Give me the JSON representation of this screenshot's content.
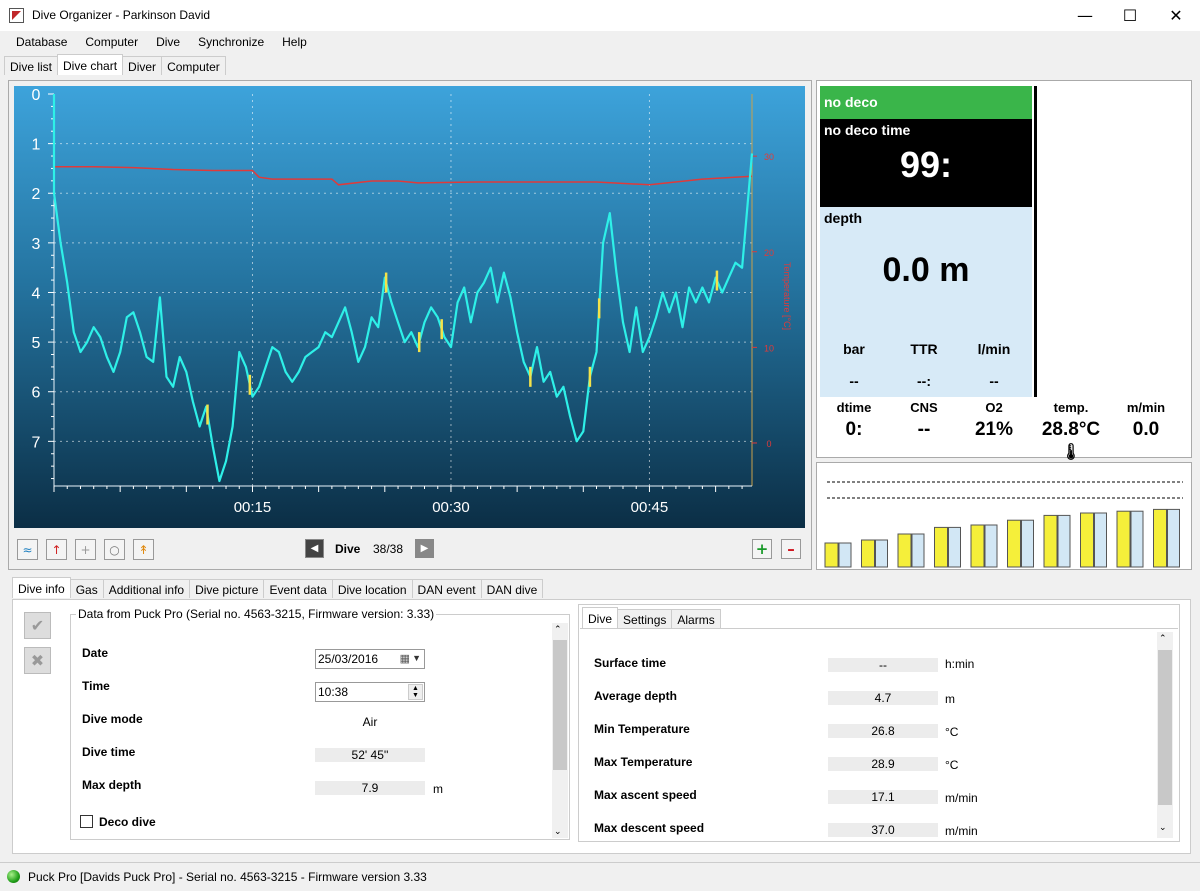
{
  "window": {
    "title": "Dive Organizer - Parkinson David"
  },
  "menu": [
    "Database",
    "Computer",
    "Dive",
    "Synchronize",
    "Help"
  ],
  "main_tabs": {
    "items": [
      "Dive list",
      "Dive chart",
      "Diver",
      "Computer"
    ],
    "active": "Dive chart"
  },
  "chart_data": {
    "type": "line",
    "ylim": [
      0,
      7.9
    ],
    "y_ticks": [
      "0",
      "1",
      "2",
      "3",
      "4",
      "5",
      "6",
      "7"
    ],
    "x_ticks": [
      "00:15",
      "00:30",
      "00:45"
    ],
    "x_tick_minutes": [
      15,
      30,
      45
    ],
    "xlim_minutes": [
      0,
      52.75
    ],
    "temp_ticks": [
      "30",
      "20",
      "10",
      "0"
    ],
    "temp_tick_values": [
      30,
      20,
      10,
      0
    ],
    "temp_ylim": [
      -4.5,
      36.5
    ],
    "temp_axis_label": "Temperature [°C]",
    "series": [
      {
        "key": "depth",
        "color": "#2ef0e8",
        "x": [
          0,
          0.5,
          1,
          1.5,
          2,
          2.5,
          3,
          3.5,
          4,
          4.5,
          5,
          5.5,
          6,
          6.5,
          7,
          7.5,
          8,
          8.5,
          9,
          9.5,
          10,
          10.5,
          11,
          11.5,
          12,
          12.5,
          13,
          13.5,
          14,
          14.5,
          15,
          15.5,
          16,
          16.5,
          17,
          17.5,
          18,
          18.5,
          19,
          19.5,
          20,
          20.5,
          21,
          21.5,
          22,
          22.5,
          23,
          23.5,
          24,
          24.5,
          25,
          25.5,
          26,
          26.5,
          27,
          27.5,
          28,
          28.5,
          29,
          29.5,
          30,
          30.5,
          31,
          31.5,
          32,
          32.5,
          33,
          33.5,
          34,
          34.5,
          35,
          35.5,
          36,
          36.5,
          37,
          37.5,
          38,
          38.5,
          39,
          39.5,
          40,
          40.5,
          41,
          41.5,
          42,
          42.5,
          43,
          43.5,
          44,
          44.5,
          45,
          45.5,
          46,
          46.5,
          47,
          47.5,
          48,
          48.5,
          49,
          49.5,
          50,
          50.5,
          51,
          51.5,
          52,
          52.75
        ],
        "values": [
          2.0,
          3.0,
          3.8,
          4.8,
          5.2,
          5.0,
          4.7,
          4.9,
          5.3,
          5.6,
          5.2,
          4.5,
          4.4,
          4.8,
          5.3,
          5.4,
          4.1,
          5.7,
          5.9,
          5.3,
          5.6,
          6.2,
          6.7,
          6.3,
          7.1,
          7.8,
          7.4,
          6.7,
          5.2,
          5.5,
          6.1,
          5.9,
          5.5,
          5.1,
          5.2,
          5.6,
          5.8,
          5.6,
          5.3,
          5.2,
          5.1,
          4.8,
          4.9,
          4.6,
          4.3,
          4.8,
          5.4,
          5.1,
          4.5,
          4.7,
          3.7,
          4.2,
          4.6,
          5.0,
          4.8,
          5.1,
          4.6,
          4.3,
          4.5,
          4.9,
          5.1,
          4.2,
          3.9,
          4.6,
          4.0,
          3.8,
          3.5,
          4.2,
          3.6,
          4.1,
          4.8,
          5.4,
          5.7,
          5.1,
          5.8,
          5.6,
          6.1,
          5.9,
          6.5,
          7.0,
          6.8,
          5.7,
          5.2,
          3.0,
          2.4,
          3.6,
          4.6,
          5.2,
          4.3,
          5.2,
          4.9,
          4.5,
          4.0,
          4.4,
          4.0,
          4.7,
          3.9,
          4.2,
          3.9,
          4.2,
          3.7,
          4.0,
          3.7,
          3.4,
          3.5,
          1.2
        ],
        "highlight_x": [
          11.6,
          14.8,
          25.1,
          27.6,
          29.3,
          36.0,
          40.5,
          41.2,
          50.1
        ]
      },
      {
        "key": "temperature",
        "color": "#e03a3a",
        "x": [
          0,
          3,
          6,
          9,
          12,
          15,
          15.5,
          16.5,
          21,
          21.5,
          24,
          26,
          27.5,
          32,
          37,
          41,
          45,
          49,
          52.75
        ],
        "values": [
          28.9,
          28.9,
          28.8,
          28.6,
          28.5,
          28.5,
          27.8,
          27.6,
          27.6,
          27.0,
          27.4,
          27.4,
          27.2,
          27.3,
          27.3,
          27.3,
          27.0,
          27.6,
          27.9
        ]
      }
    ]
  },
  "chart_toolbar": {
    "dive_label": "Dive",
    "dive_counter": "38/38"
  },
  "computer_display": {
    "status": "no deco",
    "ndt_label": "no deco time",
    "ndt_value": "99:",
    "depth_label": "depth",
    "depth_value": "0.0 m",
    "sub_labels": [
      "bar",
      "TTR",
      "l/min"
    ],
    "sub_values": [
      "--",
      "--:",
      "--"
    ],
    "stats": [
      {
        "label": "dtime",
        "value": "0:"
      },
      {
        "label": "CNS",
        "value": "--"
      },
      {
        "label": "O2",
        "value": "21%"
      },
      {
        "label": "temp.",
        "value": "28.8°C"
      },
      {
        "label": "m/min",
        "value": "0.0"
      }
    ]
  },
  "tissue_bars": {
    "saturation": [
      0.4,
      0.45,
      0.55,
      0.66,
      0.7,
      0.78,
      0.86,
      0.9,
      0.93,
      0.96
    ],
    "colors": {
      "yellow": "#f5ef3a",
      "blue": "#d2e7f5"
    }
  },
  "bottom_tabs": {
    "items": [
      "Dive info",
      "Gas",
      "Additional info",
      "Dive picture",
      "Event data",
      "Dive location",
      "DAN event",
      "DAN dive"
    ],
    "active": "Dive info"
  },
  "dive_info": {
    "group_title": "Data from Puck Pro (Serial no. 4563-3215, Firmware version: 3.33)",
    "date_label": "Date",
    "date_value": "25/03/2016",
    "time_label": "Time",
    "time_value": "10:38",
    "mode_label": "Dive mode",
    "mode_value": "Air",
    "dive_time_label": "Dive time",
    "dive_time_value": "52' 45''",
    "max_depth_label": "Max depth",
    "max_depth_value": "7.9",
    "max_depth_unit": "m",
    "deco_label": "Deco dive"
  },
  "right_tabs": {
    "items": [
      "Dive",
      "Settings",
      "Alarms"
    ],
    "active": "Dive"
  },
  "dive_stats": [
    {
      "label": "Surface time",
      "value": "--",
      "unit": "h:min"
    },
    {
      "label": "Average depth",
      "value": "4.7",
      "unit": "m"
    },
    {
      "label": "Min Temperature",
      "value": "26.8",
      "unit": "°C"
    },
    {
      "label": "Max Temperature",
      "value": "28.9",
      "unit": "°C"
    },
    {
      "label": "Max ascent speed",
      "value": "17.1",
      "unit": "m/min"
    },
    {
      "label": "Max descent speed",
      "value": "37.0",
      "unit": "m/min"
    }
  ],
  "status_bar": {
    "text": "Puck Pro [Davids Puck Pro] - Serial no. 4563-3215 - Firmware version 3.33"
  }
}
